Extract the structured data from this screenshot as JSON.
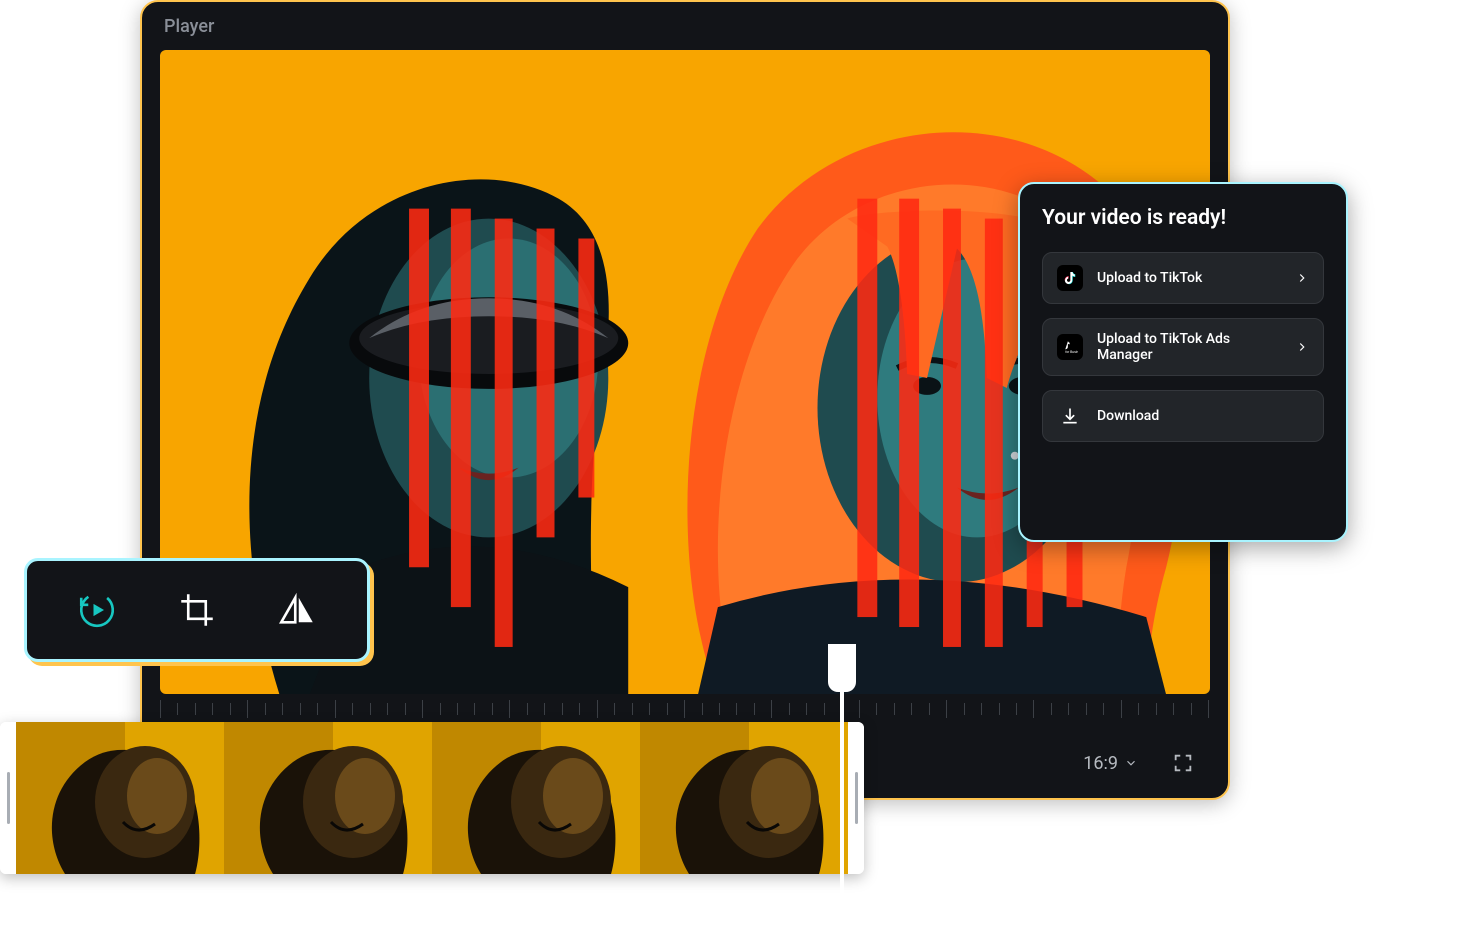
{
  "player": {
    "title": "Player",
    "aspect_ratio": "16:9"
  },
  "export": {
    "title": "Your video is ready!",
    "options": [
      {
        "icon": "tiktok-icon",
        "label": "Upload to TikTok",
        "chevron": true
      },
      {
        "icon": "tiktok-ads-icon",
        "label": "Upload to TikTok Ads Manager",
        "chevron": true
      },
      {
        "icon": "download-icon",
        "label": "Download",
        "chevron": false
      }
    ]
  },
  "toolbar": {
    "tools": [
      {
        "id": "replay",
        "icon": "replay-icon",
        "active": true
      },
      {
        "id": "crop",
        "icon": "crop-icon",
        "active": false
      },
      {
        "id": "flip",
        "icon": "flip-horizontal-icon",
        "active": false
      }
    ]
  },
  "timeline": {
    "frame_count": 4
  },
  "colors": {
    "accent_yellow": "#ffc44d",
    "accent_cyan": "#a9f4ff",
    "brand_teal": "#17c7c1",
    "dark_bg": "#121418"
  }
}
